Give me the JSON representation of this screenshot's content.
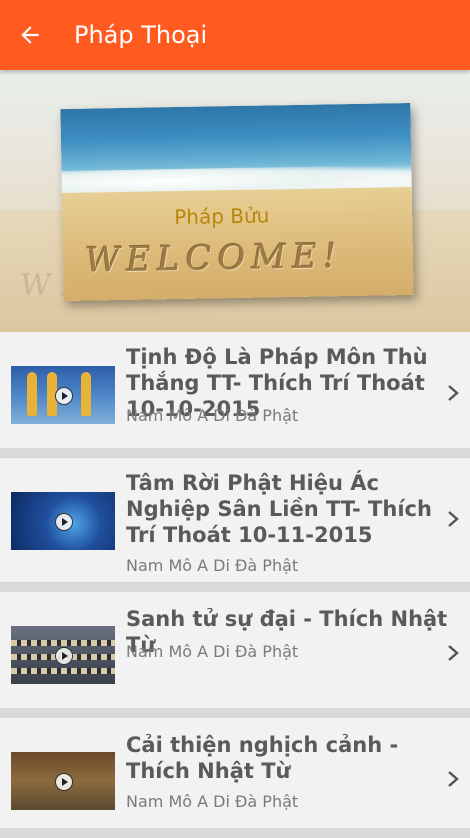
{
  "app_bar": {
    "title": "Pháp Thoại",
    "back_icon": "arrow-left-icon",
    "color": "#ff5a1f"
  },
  "banner": {
    "caption": "Pháp Bửu",
    "image_text": "WELCOME!"
  },
  "videos": [
    {
      "title": "Tịnh Độ Là Pháp Môn Thù Thắng TT- Thích Trí Thoát 10-10-2015",
      "channel": "Nam Mô A Di Đà Phật"
    },
    {
      "title": "Tâm Rời Phật Hiệu Ác Nghiệp Sân Liền TT- Thích Trí Thoát 10-11-2015",
      "channel": "Nam Mô A Di Đà Phật"
    },
    {
      "title": "Sanh tử sự đại - Thích Nhật Từ",
      "channel": "Nam Mô A Di Đà Phật"
    },
    {
      "title": "Cải thiện nghịch cảnh - Thích Nhật Từ",
      "channel": "Nam Mô A Di Đà Phật"
    }
  ]
}
